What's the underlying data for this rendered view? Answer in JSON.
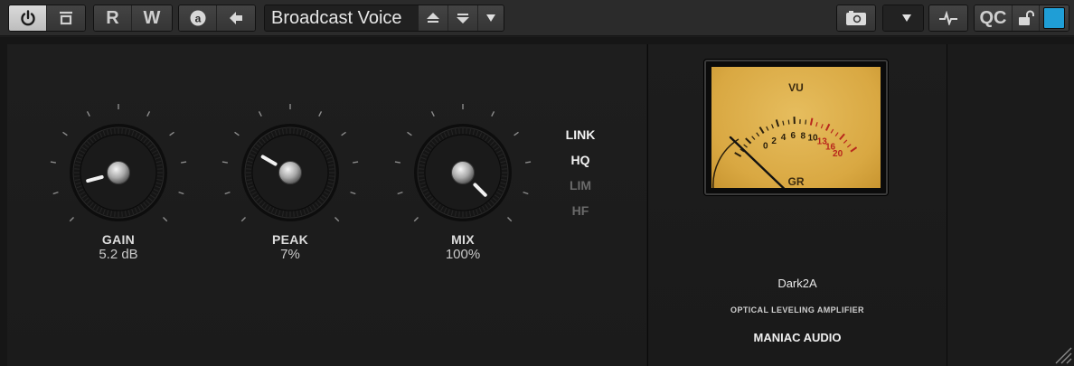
{
  "toolbar": {
    "power_icon": "power-icon",
    "bypass_icon": "bypass-icon",
    "read_label": "R",
    "write_label": "W",
    "auto_icon": "automation-icon",
    "back_icon": "arrow-left-icon",
    "preset_name": "Broadcast Voice",
    "snapshot_icon": "camera-icon",
    "sidechain_icon": "sidechain-icon",
    "qc_label": "QC",
    "lock_icon": "unlock-icon",
    "accent_color": "#1f9ed6"
  },
  "knobs": {
    "gain": {
      "label": "GAIN",
      "value": "5.2 dB"
    },
    "peak": {
      "label": "PEAK",
      "value": "7%"
    },
    "mix": {
      "label": "MIX",
      "value": "100%"
    }
  },
  "switches": [
    {
      "label": "LINK",
      "state": "on"
    },
    {
      "label": "HQ",
      "state": "on"
    },
    {
      "label": "LIM",
      "state": "off"
    },
    {
      "label": "HF",
      "state": "off"
    }
  ],
  "meter": {
    "title": "VU",
    "unit": "GR",
    "scale": [
      "0",
      "2",
      "4",
      "6",
      "8",
      "10",
      "13",
      "16",
      "20"
    ],
    "red_from": "13"
  },
  "branding": {
    "product": "Dark2A",
    "description": "OPTICAL LEVELING AMPLIFIER",
    "company": "MANIAC AUDIO"
  }
}
